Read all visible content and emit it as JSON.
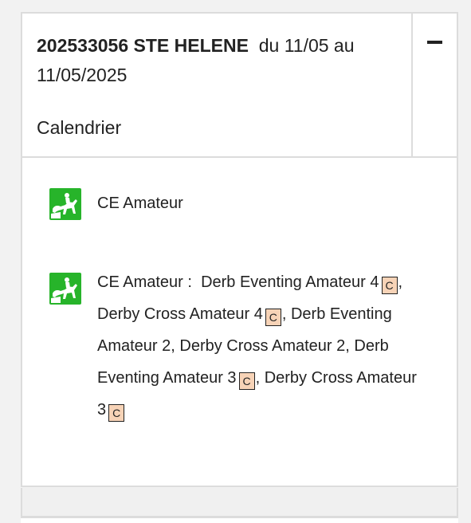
{
  "header": {
    "code_name": "202533056 STE HELENE",
    "dates": "du 11/05 au 11/05/2025",
    "subtitle": "Calendrier",
    "collapse_icon": "minus-icon"
  },
  "entries": [
    {
      "icon": "horse-rider-icon",
      "text": "CE Amateur"
    },
    {
      "icon": "horse-rider-icon",
      "prefix": "CE Amateur :",
      "items": [
        {
          "name": "Derb Eventing Amateur 4",
          "badge": "C"
        },
        {
          "name": "Derby Cross Amateur 4",
          "badge": "C"
        },
        {
          "name": "Derb Eventing Amateur 2",
          "badge": ""
        },
        {
          "name": "Derby Cross Amateur 2",
          "badge": ""
        },
        {
          "name": "Derb Eventing Amateur 3",
          "badge": "C"
        },
        {
          "name": "Derby Cross Amateur 3",
          "badge": "C"
        }
      ]
    }
  ],
  "colors": {
    "icon_bg": "#27b42a",
    "badge_bg": "#f7d3b7"
  }
}
